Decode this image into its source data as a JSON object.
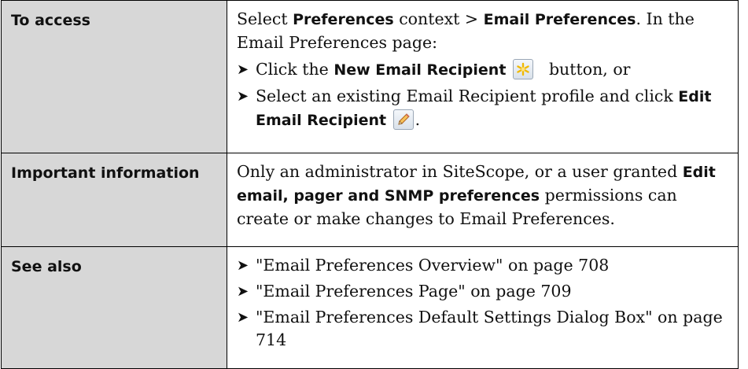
{
  "rows": [
    {
      "label": "To access",
      "intro": {
        "t1": "Select ",
        "b1": "Preferences",
        "t2": " context > ",
        "b2": "Email Preferences",
        "t3": ". In the Email Preferences page:"
      },
      "bullets": [
        {
          "t1": "Click the ",
          "b1": "New Email Recipient",
          "icon": "new-recipient-star-icon",
          "t2": "button, or"
        },
        {
          "t1": "Select an existing Email Recipient profile and click ",
          "b1": "Edit Email Recipient",
          "icon": "edit-pencil-icon",
          "t2": "."
        }
      ]
    },
    {
      "label": "Important information",
      "t1": "Only an administrator in SiteScope, or a user granted ",
      "b1": "Edit email, pager and SNMP preferences",
      "t2": " permissions can create or make changes to Email Preferences."
    },
    {
      "label": "See also",
      "links": [
        "\"Email Preferences Overview\" on page 708",
        "\"Email Preferences Page\" on page 709",
        "\"Email Preferences Default Settings Dialog Box\" on page 714"
      ]
    }
  ],
  "colors": {
    "label_bg": "#d7d7d7",
    "border": "#000000",
    "star_icon": "#f0b800"
  }
}
